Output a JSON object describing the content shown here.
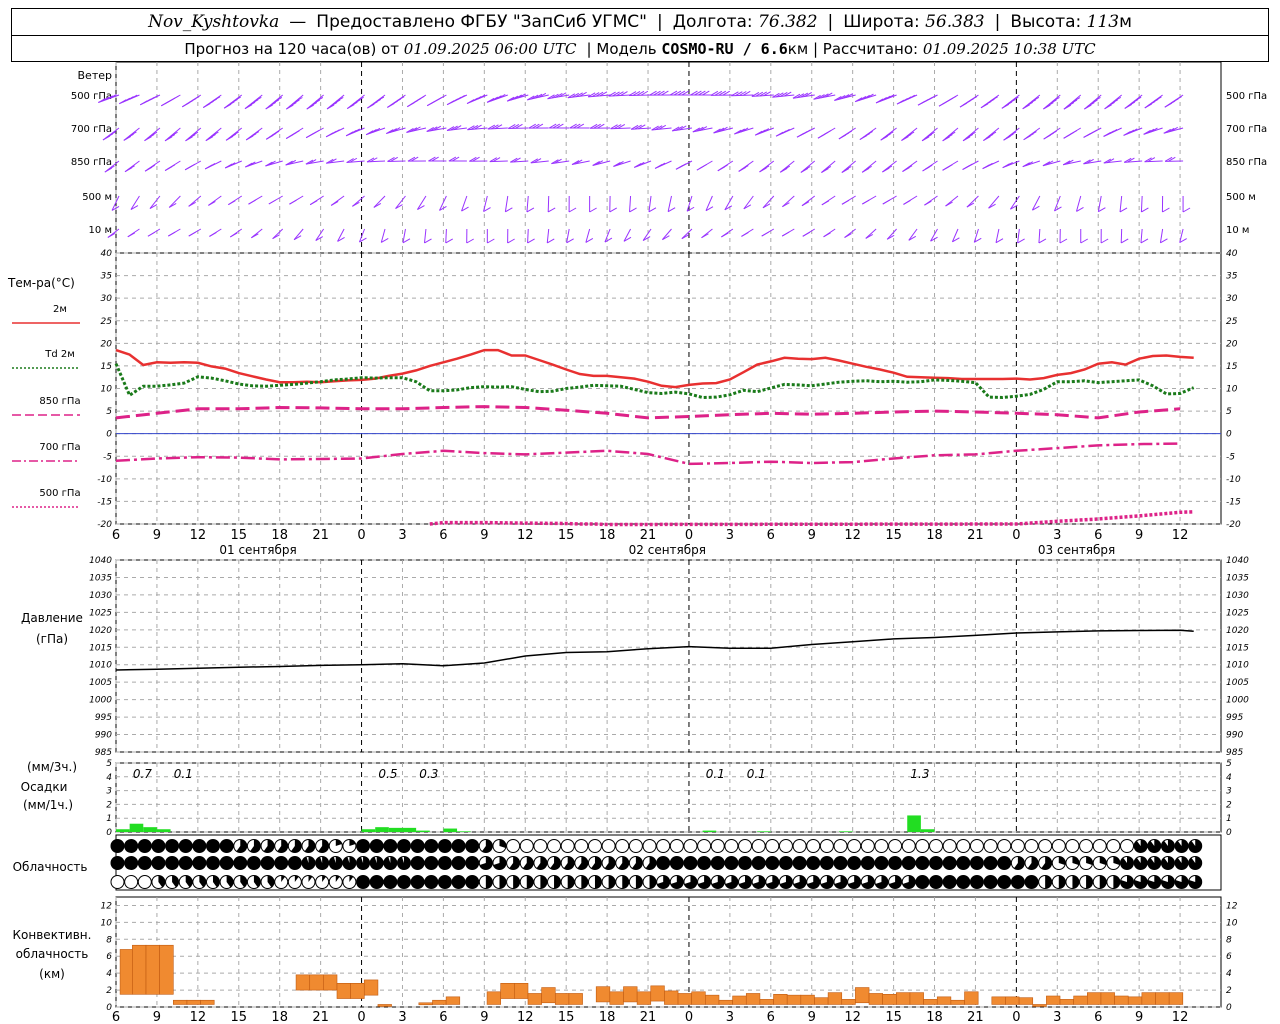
{
  "header": {
    "station": "Nov_Kyshtovka",
    "dash": "—",
    "provider": "Предоставлено ФГБУ \"ЗапСиб УГМС\"",
    "sep": "|",
    "lon_label": "Долгота:",
    "lon_value": "76.382",
    "lat_label": "Широта:",
    "lat_value": "56.383",
    "alt_label": "Высота:",
    "alt_value": "113",
    "alt_unit": "м",
    "forecast_label": "Прогноз на 120 часа(ов) от",
    "forecast_from": "01.09.2025 06:00 UTC",
    "model_label": "Модель",
    "model_name": "COSMO-RU / 6.6",
    "model_unit": "км",
    "calc_label": "Рассчитано:",
    "calc_time": "01.09.2025 10:38 UTC"
  },
  "time_axis": {
    "hours": [
      "6",
      "9",
      "12",
      "15",
      "18",
      "21",
      "0",
      "3",
      "6",
      "9",
      "12",
      "15",
      "18",
      "21",
      "0",
      "3",
      "6",
      "9",
      "12",
      "15",
      "18",
      "21",
      "0",
      "3",
      "6",
      "9",
      "12"
    ],
    "dates": [
      "01 сентября",
      "02 сентября",
      "03 сентября"
    ]
  },
  "wind_panel": {
    "title": "Ветер",
    "levels": [
      "500 гПа",
      "700 гПа",
      "850 гПа",
      "500 м",
      "10 м"
    ],
    "color": "#9933ff"
  },
  "temp_panel": {
    "title": "Тем-ра(°С)",
    "legend": [
      {
        "label": "2м",
        "color": "#e83030",
        "style": "solid"
      },
      {
        "label": "Td 2м",
        "color": "#1a7a1a",
        "style": "dotted"
      },
      {
        "label": "850 гПа",
        "color": "#dd2288",
        "style": "dashed"
      },
      {
        "label": "700 гПа",
        "color": "#dd2288",
        "style": "dashdot"
      },
      {
        "label": "500 гПа",
        "color": "#dd2288",
        "style": "dotted"
      }
    ],
    "y_ticks": [
      "40",
      "35",
      "30",
      "25",
      "20",
      "15",
      "10",
      "5",
      "0",
      "-5",
      "-10",
      "-15",
      "-20"
    ]
  },
  "pressure_panel": {
    "title": "Давление",
    "unit": "(гПа)",
    "y_ticks": [
      "1040",
      "1035",
      "1030",
      "1025",
      "1020",
      "1015",
      "1010",
      "1005",
      "1000",
      "995",
      "990",
      "985"
    ]
  },
  "precip_panel": {
    "unit_top": "(мм/3ч.)",
    "title": "Осадки",
    "unit_bottom": "(мм/1ч.)",
    "y_ticks": [
      "5",
      "4",
      "3",
      "2",
      "1",
      "0"
    ],
    "totals": [
      {
        "hour": 1.2,
        "text": "0.7"
      },
      {
        "hour": 4.2,
        "text": "0.1"
      },
      {
        "hour": 19.2,
        "text": "0.5"
      },
      {
        "hour": 22.2,
        "text": "0.3"
      },
      {
        "hour": 43.2,
        "text": "0.1"
      },
      {
        "hour": 46.2,
        "text": "0.1"
      },
      {
        "hour": 58.2,
        "text": "1.3"
      }
    ],
    "color": "#22dd22"
  },
  "cloud_panel": {
    "title": "Облачность"
  },
  "conv_panel": {
    "title_line1": "Конвективн.",
    "title_line2": "облачность",
    "unit": "(км)",
    "y_ticks": [
      "12",
      "10",
      "8",
      "6",
      "4",
      "2",
      "0"
    ],
    "color": "#f08a30"
  },
  "chart_data": [
    {
      "type": "line",
      "title": "Тем-ра(°С)",
      "ylim": [
        -20,
        40
      ],
      "x_unit": "hours since 01.09.2025 06:00 UTC",
      "series": [
        {
          "name": "2м",
          "x": [
            0,
            1,
            2,
            3,
            4,
            5,
            6,
            7,
            8,
            9,
            10,
            11,
            12,
            13,
            14,
            15,
            16,
            17,
            18,
            19,
            20,
            21,
            22,
            23,
            24,
            25,
            26,
            27,
            28,
            29,
            30,
            31,
            32,
            33,
            34,
            35,
            36,
            37,
            38,
            39,
            40,
            41,
            42,
            43,
            44,
            45,
            46,
            47,
            48,
            49,
            50,
            51,
            52,
            53,
            54,
            55,
            56,
            57,
            58,
            59,
            60,
            61,
            62,
            63,
            64,
            65,
            66,
            67,
            68,
            69,
            70,
            71,
            72,
            73,
            74,
            75,
            76,
            77,
            78,
            79
          ],
          "values": [
            18.5,
            17.5,
            15.2,
            15.8,
            15.7,
            15.8,
            15.7,
            14.9,
            14.4,
            13.4,
            12.7,
            12,
            11.4,
            11.4,
            11.5,
            11.4,
            11.6,
            11.8,
            11.9,
            12.2,
            12.8,
            13.3,
            14,
            15,
            15.8,
            16.6,
            17.5,
            18.5,
            18.5,
            17.3,
            17.3,
            16.3,
            15.3,
            14.2,
            13.2,
            12.8,
            12.8,
            12.5,
            12.2,
            11.5,
            10.6,
            10.3,
            10.8,
            11.1,
            11.2,
            12,
            13.6,
            15.3,
            16,
            16.8,
            16.6,
            16.5,
            16.8,
            16.2,
            15.5,
            14.8,
            14.2,
            13.5,
            12.6,
            12.5,
            12.4,
            12.3,
            12.1,
            12.1,
            12.1,
            12.1,
            12.2,
            12,
            12.3,
            13,
            13.4,
            14.2,
            15.5,
            15.8,
            15.3,
            16.6,
            17.2,
            17.3,
            17,
            16.8
          ]
        },
        {
          "name": "Td 2м",
          "x": [
            0,
            1,
            2,
            3,
            4,
            5,
            6,
            7,
            8,
            9,
            10,
            11,
            12,
            13,
            14,
            15,
            16,
            17,
            18,
            19,
            20,
            21,
            22,
            23,
            24,
            25,
            26,
            27,
            28,
            29,
            30,
            31,
            32,
            33,
            34,
            35,
            36,
            37,
            38,
            39,
            40,
            41,
            42,
            43,
            44,
            45,
            46,
            47,
            48,
            49,
            50,
            51,
            52,
            53,
            54,
            55,
            56,
            57,
            58,
            59,
            60,
            61,
            62,
            63,
            64,
            65,
            66,
            67,
            68,
            69,
            70,
            71,
            72,
            73,
            74,
            75,
            76,
            77,
            78,
            79
          ],
          "values": [
            15.5,
            8.5,
            10.5,
            10.5,
            10.8,
            11.2,
            12.6,
            12.3,
            11.7,
            11,
            10.6,
            10.5,
            10.7,
            10.9,
            11.2,
            11.5,
            11.9,
            12.1,
            12.4,
            12.3,
            12.4,
            12.4,
            11.5,
            9.5,
            9.5,
            9.7,
            10.2,
            10.4,
            10.3,
            10.4,
            9.8,
            9.3,
            9.4,
            10,
            10.3,
            10.7,
            10.6,
            10.5,
            9.8,
            9.1,
            8.9,
            9.2,
            8.8,
            8,
            8.1,
            8.6,
            9.6,
            9.3,
            10.1,
            10.9,
            10.8,
            10.6,
            11,
            11.4,
            11.6,
            11.7,
            11.5,
            11.6,
            11.4,
            11.5,
            11.9,
            11.8,
            11.6,
            11.3,
            8.1,
            8,
            8.3,
            8.7,
            9.8,
            11.5,
            11.5,
            11.7,
            11.3,
            11.5,
            11.7,
            11.9,
            10.6,
            8.8,
            8.9,
            10.2
          ]
        },
        {
          "name": "850 гПа",
          "x": [
            0,
            3,
            6,
            9,
            12,
            15,
            18,
            21,
            24,
            27,
            30,
            33,
            36,
            39,
            42,
            45,
            48,
            51,
            54,
            57,
            60,
            63,
            66,
            69,
            72,
            75,
            78
          ],
          "values": [
            3.5,
            4.5,
            5.5,
            5.5,
            5.8,
            5.7,
            5.5,
            5.5,
            5.8,
            6,
            5.8,
            5.2,
            4.5,
            3.5,
            3.8,
            4.2,
            4.5,
            4.3,
            4.5,
            4.8,
            5,
            4.8,
            4.5,
            4.2,
            3.5,
            4.8,
            5.5
          ]
        },
        {
          "name": "700 гПа",
          "x": [
            0,
            3,
            6,
            9,
            12,
            15,
            18,
            21,
            24,
            27,
            30,
            33,
            36,
            39,
            42,
            45,
            48,
            51,
            54,
            57,
            60,
            63,
            66,
            69,
            72,
            75,
            78
          ],
          "values": [
            -6,
            -5.5,
            -5.2,
            -5.3,
            -5.7,
            -5.6,
            -5.5,
            -4.5,
            -3.8,
            -4.3,
            -4.6,
            -4.2,
            -3.8,
            -4.5,
            -6.7,
            -6.5,
            -6.2,
            -6.5,
            -6.3,
            -5.5,
            -4.8,
            -4.6,
            -3.8,
            -3.2,
            -2.6,
            -2.3,
            -2.2
          ]
        },
        {
          "name": "500 гПа",
          "x": [
            23,
            24,
            27,
            30,
            33,
            34,
            35,
            36,
            66,
            69,
            72,
            75,
            78,
            79
          ],
          "values": [
            -20,
            -19.7,
            -19.7,
            -19.8,
            -19.9,
            -20,
            -20,
            -20.1,
            -20,
            -19.4,
            -18.9,
            -18.2,
            -17.4,
            -17.3
          ]
        }
      ]
    },
    {
      "type": "line",
      "title": "Давление",
      "ylim": [
        985,
        1040
      ],
      "x_unit": "hours since 01.09.2025 06:00 UTC",
      "series": [
        {
          "name": "",
          "x": [
            0,
            3,
            6,
            9,
            12,
            15,
            18,
            21,
            24,
            27,
            30,
            33,
            36,
            39,
            42,
            45,
            48,
            51,
            54,
            57,
            60,
            63,
            66,
            69,
            72,
            75,
            78,
            79
          ],
          "values": [
            1008.5,
            1008.7,
            1009,
            1009.3,
            1009.5,
            1009.8,
            1010,
            1010.3,
            1009.7,
            1010.5,
            1012.5,
            1013.5,
            1013.7,
            1014.6,
            1015.2,
            1014.7,
            1014.7,
            1015.8,
            1016.6,
            1017.4,
            1017.8,
            1018.4,
            1019.1,
            1019.4,
            1019.7,
            1019.8,
            1019.9,
            1019.6
          ]
        }
      ]
    },
    {
      "type": "bar",
      "title": "Осадки",
      "ylim": [
        0,
        5
      ],
      "x_unit": "hours since 01.09.2025 06:00 UTC",
      "series": [
        {
          "name": "",
          "x": [
            0,
            1,
            2,
            3,
            18,
            19,
            20,
            21,
            22,
            23,
            24,
            25,
            43,
            47,
            53,
            58,
            59
          ],
          "values": [
            0.2,
            0.6,
            0.35,
            0.2,
            0.2,
            0.35,
            0.3,
            0.3,
            0.1,
            0,
            0.25,
            0.05,
            0.1,
            0.05,
            0.05,
            1.2,
            0.2
          ]
        }
      ]
    },
    {
      "type": "bar",
      "title": "Конвективн. облачность",
      "ylim": [
        0,
        12
      ],
      "x_unit": "hours since 01.09.2025 06:00 UTC",
      "intervals_km": [
        [
          0.3,
          1.2,
          6.8
        ],
        [
          1.2,
          2.2,
          7.3
        ],
        [
          2.2,
          3.2,
          7.3
        ],
        [
          3.2,
          4.2,
          7.3
        ],
        [
          4.2,
          5.2,
          0.8
        ],
        [
          5.2,
          6.2,
          0.8
        ],
        [
          6.2,
          7.2,
          0.8
        ],
        [
          13.2,
          14.2,
          3.8
        ],
        [
          14.2,
          15.2,
          3.8
        ],
        [
          15.2,
          16.2,
          3.8
        ],
        [
          16.2,
          17.2,
          2.8
        ],
        [
          17.2,
          18.2,
          2.8
        ],
        [
          18.2,
          19.2,
          3.2
        ],
        [
          19.2,
          20.2,
          0.3
        ],
        [
          20.2,
          21.2,
          0
        ],
        [
          21.2,
          22.2,
          0
        ],
        [
          22.2,
          23.2,
          0.5
        ],
        [
          23.2,
          24.2,
          0.8
        ],
        [
          24.2,
          25.2,
          1.2
        ],
        [
          27.2,
          28.2,
          1.8
        ],
        [
          28.2,
          29.2,
          2.8
        ],
        [
          29.2,
          30.2,
          2.8
        ],
        [
          30.2,
          31.2,
          1.6
        ],
        [
          31.2,
          32.2,
          2.3
        ],
        [
          32.2,
          33.2,
          1.6
        ],
        [
          33.2,
          34.2,
          1.6
        ],
        [
          35.2,
          36.2,
          2.4
        ],
        [
          36.2,
          37.2,
          1.8
        ],
        [
          37.2,
          38.2,
          2.4
        ],
        [
          38.2,
          39.2,
          1.8
        ],
        [
          39.2,
          40.2,
          2.5
        ],
        [
          40.2,
          41.2,
          1.9
        ],
        [
          41.2,
          42.2,
          1.6
        ],
        [
          42.2,
          43.2,
          1.8
        ],
        [
          43.2,
          44.2,
          1.4
        ],
        [
          44.2,
          45.2,
          0.8
        ],
        [
          45.2,
          46.2,
          1.3
        ],
        [
          46.2,
          47.2,
          1.6
        ],
        [
          47.2,
          48.2,
          0.9
        ],
        [
          48.2,
          49.2,
          1.5
        ],
        [
          49.2,
          50.2,
          1.4
        ],
        [
          50.2,
          51.2,
          1.4
        ],
        [
          51.2,
          52.2,
          1.1
        ],
        [
          52.2,
          53.2,
          1.7
        ],
        [
          53.2,
          54.2,
          0.9
        ],
        [
          54.2,
          55.2,
          2.3
        ],
        [
          55.2,
          56.2,
          1.6
        ],
        [
          56.2,
          57.2,
          1.5
        ],
        [
          57.2,
          58.2,
          1.7
        ],
        [
          58.2,
          59.2,
          1.7
        ],
        [
          59.2,
          60.2,
          0.9
        ],
        [
          60.2,
          61.2,
          1.2
        ],
        [
          61.2,
          62.2,
          0.8
        ],
        [
          62.2,
          63.2,
          1.8
        ],
        [
          63.2,
          64.2,
          0.2
        ],
        [
          64.2,
          65.2,
          1.2
        ],
        [
          65.2,
          66.2,
          1.2
        ],
        [
          66.2,
          67.2,
          1.1
        ],
        [
          67.2,
          68.2,
          0.3
        ],
        [
          68.2,
          69.2,
          1.3
        ],
        [
          69.2,
          70.2,
          0.9
        ],
        [
          70.2,
          71.2,
          1.3
        ],
        [
          71.2,
          72.2,
          1.7
        ],
        [
          72.2,
          73.2,
          1.7
        ],
        [
          73.2,
          74.2,
          1.3
        ],
        [
          74.2,
          75.2,
          1.2
        ],
        [
          75.2,
          76.2,
          1.7
        ],
        [
          76.2,
          77.2,
          1.7
        ],
        [
          77.2,
          78.2,
          1.7
        ]
      ]
    }
  ]
}
